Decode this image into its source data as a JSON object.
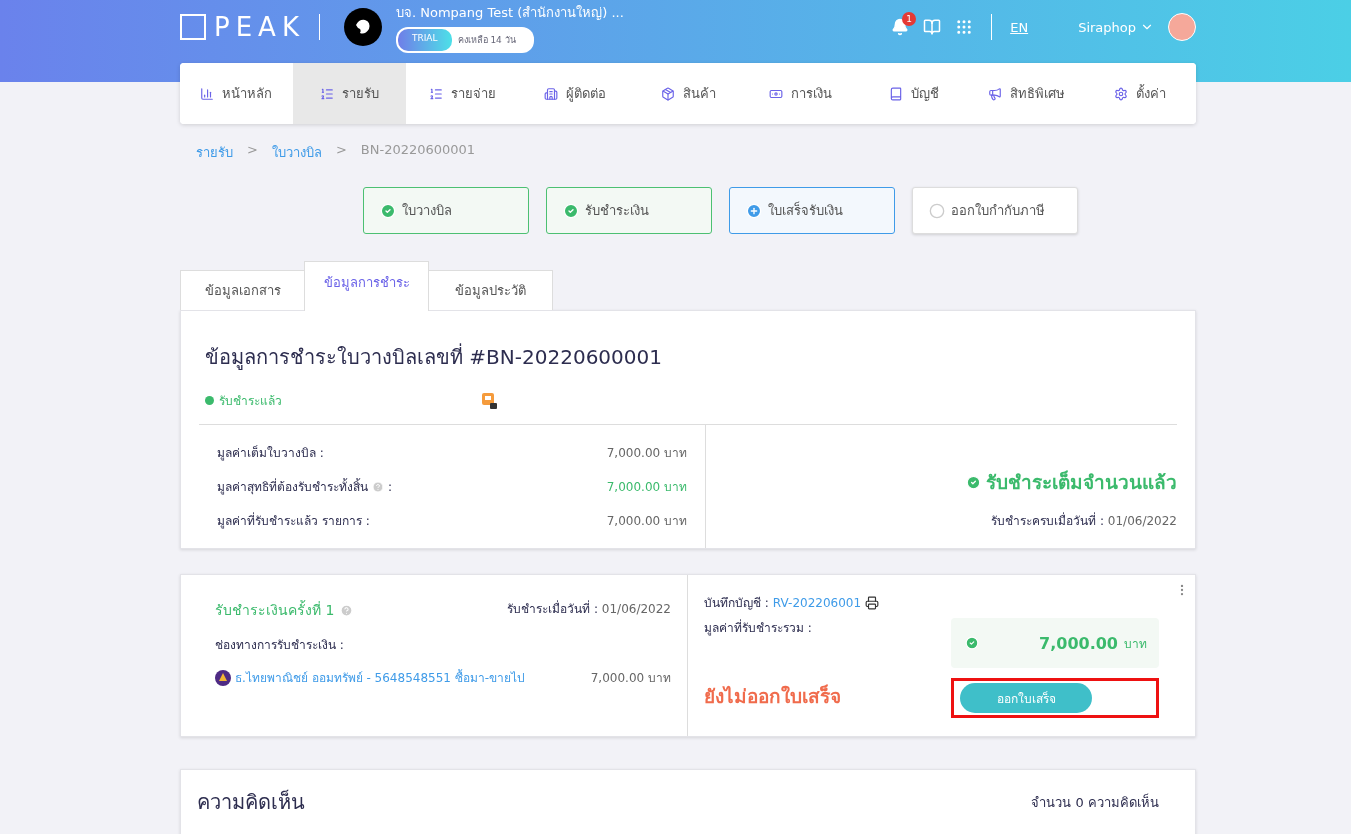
{
  "header": {
    "logo": "PEAK",
    "company": "บจ. Nompang Test (สำนักงานใหญ่) ...",
    "trial_badge": "TRIAL",
    "trial_remaining": "คงเหลือ 14 วัน",
    "notification_count": "1",
    "language": "EN",
    "user": "Siraphop"
  },
  "nav": [
    {
      "label": "หน้าหลัก",
      "selected": false
    },
    {
      "label": "รายรับ",
      "selected": true
    },
    {
      "label": "รายจ่าย",
      "selected": false
    },
    {
      "label": "ผู้ติดต่อ",
      "selected": false
    },
    {
      "label": "สินค้า",
      "selected": false
    },
    {
      "label": "การเงิน",
      "selected": false
    },
    {
      "label": "บัญชี",
      "selected": false
    },
    {
      "label": "สิทธิพิเศษ",
      "selected": false
    },
    {
      "label": "ตั้งค่า",
      "selected": false
    }
  ],
  "breadcrumb": [
    {
      "label": "รายรับ",
      "kind": "link"
    },
    {
      "label": ">",
      "kind": "separator"
    },
    {
      "label": "ใบวางบิล",
      "kind": "link"
    },
    {
      "label": ">",
      "kind": "separator"
    },
    {
      "label": "BN-20220600001",
      "kind": "current"
    }
  ],
  "steps": [
    {
      "label": "ใบวางบิล",
      "kind": "done"
    },
    {
      "label": "รับชำระเงิน",
      "kind": "done"
    },
    {
      "label": "ใบเสร็จรับเงิน",
      "kind": "current"
    },
    {
      "label": "ออกใบกำกับภาษี",
      "kind": "pending"
    }
  ],
  "tabs": [
    {
      "label": "ข้อมูลเอกสาร",
      "selected": false
    },
    {
      "label": "ข้อมูลการชำระ",
      "selected": true
    },
    {
      "label": "ข้อมูลประวัติ",
      "selected": false
    }
  ],
  "summary": {
    "title": "ข้อมูลการชำระใบวางบิลเลขที่ #BN-20220600001",
    "status": "รับชำระแล้ว",
    "rows": [
      {
        "label": "มูลค่าเต็มใบวางบิล :",
        "value": "7,000.00 บาท",
        "help": false,
        "highlight": false
      },
      {
        "label": "มูลค่าสุทธิที่ต้องรับชำระทั้งสิ้น",
        "suffix": ":",
        "value": "7,000.00 บาท",
        "help": true,
        "highlight": true
      },
      {
        "label": "มูลค่าที่รับชำระแล้ว รายการ :",
        "value": "7,000.00 บาท",
        "help": false,
        "highlight": false
      }
    ],
    "result": "รับชำระเต็มจำนวนแล้ว",
    "date_label": "รับชำระครบเมื่อวันที่ :",
    "date": "01/06/2022"
  },
  "payment": {
    "title": "รับชำระเงินครั้งที่ 1",
    "date_label": "รับชำระเมื่อวันที่ :",
    "date": "01/06/2022",
    "channel_label": "ช่องทางการรับชำระเงิน :",
    "channel": "ธ.ไทยพาณิชย์ ออมทรัพย์ - 5648548551 ซื้อมา-ขายไป",
    "channel_amount": "7,000.00 บาท",
    "account_label": "บันทึกบัญชี :",
    "account": "RV-202206001",
    "total_label": "มูลค่าที่รับชำระรวม :",
    "total": "7,000.00",
    "unit": "บาท",
    "receipt_status": "ยังไม่ออกใบเสร็จ",
    "button": "ออกใบเสร็จ",
    "button_highlighted": true
  },
  "comments": {
    "title": "ความคิดเห็น",
    "count": "จำนวน 0 ความคิดเห็น"
  }
}
